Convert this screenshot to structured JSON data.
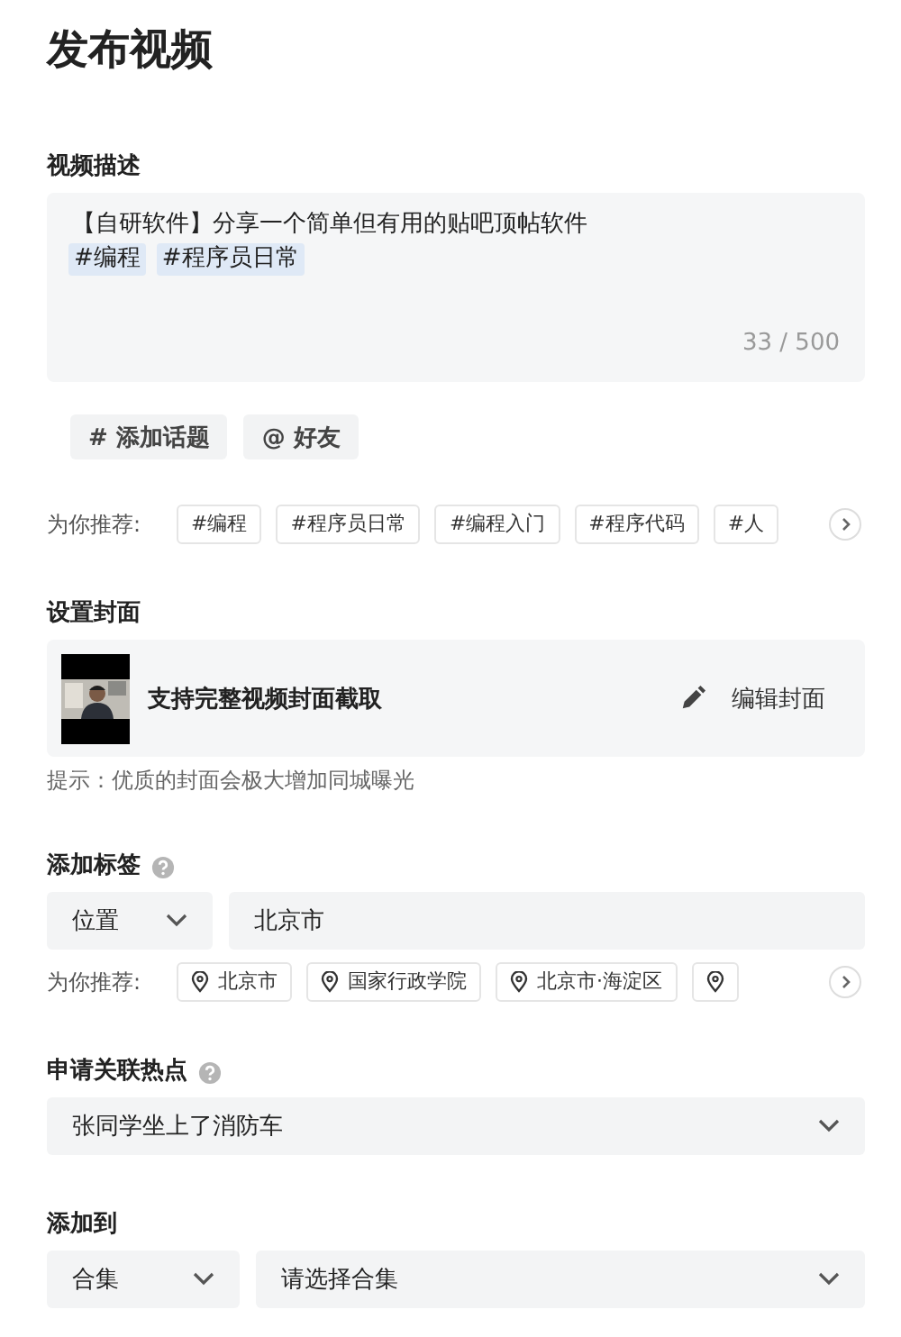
{
  "title": "发布视频",
  "description": {
    "label": "视频描述",
    "text": "【自研软件】分享一个简单但有用的贴吧顶帖软件",
    "hashtags": [
      "#编程",
      "#程序员日常"
    ],
    "counter": "33 / 500"
  },
  "actions": [
    {
      "icon": "#",
      "label": "添加话题"
    },
    {
      "icon": "@",
      "label": "好友"
    }
  ],
  "topic_recommend": {
    "label": "为你推荐:",
    "items": [
      "#编程",
      "#程序员日常",
      "#编程入门",
      "#程序代码",
      "#人"
    ]
  },
  "cover": {
    "label": "设置封面",
    "caption": "支持完整视频封面截取",
    "edit": "编辑封面",
    "hint": "提示：优质的封面会极大增加同城曝光"
  },
  "tags": {
    "label": "添加标签",
    "type": "位置",
    "value": "北京市",
    "recommend_label": "为你推荐:",
    "items": [
      "北京市",
      "国家行政学院",
      "北京市·海淀区"
    ]
  },
  "hotspot": {
    "label": "申请关联热点",
    "value": "张同学坐上了消防车"
  },
  "add_to": {
    "label": "添加到",
    "type": "合集",
    "placeholder": "请选择合集"
  }
}
